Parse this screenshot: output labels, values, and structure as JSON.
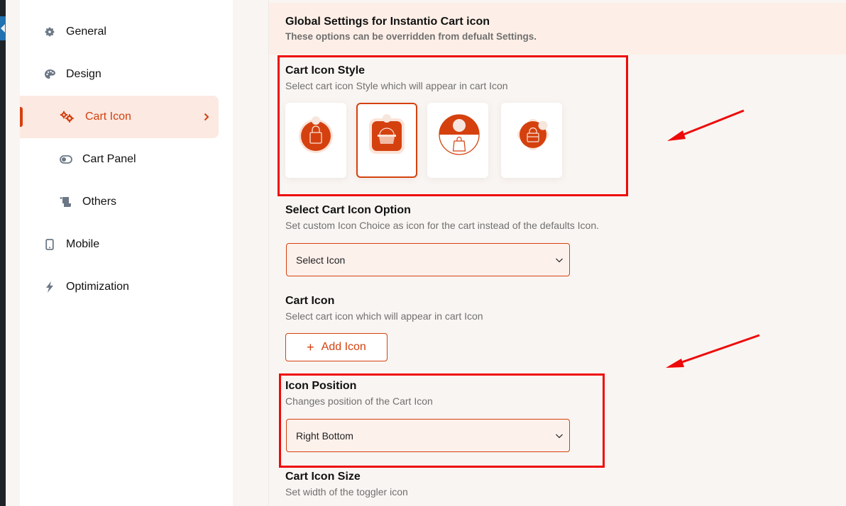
{
  "sidebar": {
    "items": [
      {
        "label": "General",
        "icon": "gear-icon",
        "level": "top"
      },
      {
        "label": "Design",
        "icon": "palette-icon",
        "level": "top"
      },
      {
        "label": "Cart Icon",
        "icon": "cogs-icon",
        "level": "sub",
        "active": true
      },
      {
        "label": "Cart Panel",
        "icon": "toggle-icon",
        "level": "sub"
      },
      {
        "label": "Others",
        "icon": "scroll-icon",
        "level": "sub"
      },
      {
        "label": "Mobile",
        "icon": "mobile-icon",
        "level": "top"
      },
      {
        "label": "Optimization",
        "icon": "bolt-icon",
        "level": "top"
      }
    ]
  },
  "banner": {
    "title": "Global Settings for Instantio Cart icon",
    "subtitle": "These options can be overridden from defualt Settings."
  },
  "cart_icon_style": {
    "title": "Cart Icon Style",
    "description": "Select cart icon Style which will appear in cart Icon",
    "options": [
      {
        "name": "circle-bag-style",
        "selected": false
      },
      {
        "name": "square-basket-style",
        "selected": true
      },
      {
        "name": "split-circle-bag-style",
        "selected": false
      },
      {
        "name": "diamond-bag-style",
        "selected": false
      }
    ]
  },
  "cart_icon_option": {
    "title": "Select Cart Icon Option",
    "description": "Set custom Icon Choice as icon for the cart instead of the defaults Icon.",
    "value": "Select Icon"
  },
  "cart_icon": {
    "title": "Cart Icon",
    "description": "Select cart icon which will appear in cart Icon",
    "button_label": "Add Icon",
    "button_icon": "+"
  },
  "icon_position": {
    "title": "Icon Position",
    "description": "Changes position of the Cart Icon",
    "value": "Right Bottom"
  },
  "cart_icon_size": {
    "title": "Cart Icon Size",
    "description": "Set width of the toggler icon"
  },
  "colors": {
    "accent": "#d4410f",
    "active_bg": "#fbe9e2",
    "annotation": "#ee0a0a"
  }
}
